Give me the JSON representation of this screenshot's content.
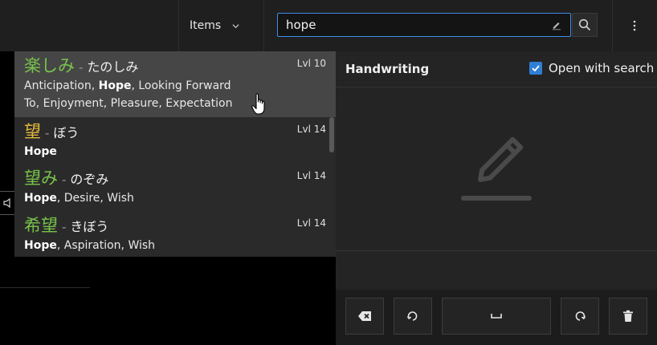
{
  "toolbar": {
    "items_label": "Items",
    "search_value": "hope"
  },
  "results": [
    {
      "word": "楽しみ",
      "reading": "たのしみ",
      "level": "Lvl 10",
      "word_color": "green",
      "meanings_line1": [
        {
          "text": "Anticipation",
          "bold": false
        },
        {
          "text": ", ",
          "bold": false
        },
        {
          "text": "Hope",
          "bold": true
        },
        {
          "text": ", Looking Forward",
          "bold": false
        }
      ],
      "meanings_line2": "To, Enjoyment, Pleasure, Expectation",
      "active": true
    },
    {
      "word": "望",
      "reading": "ぼう",
      "level": "Lvl 14",
      "word_color": "yellow",
      "meanings_line1": [
        {
          "text": "Hope",
          "bold": true
        }
      ],
      "meanings_line2": "",
      "active": false
    },
    {
      "word": "望み",
      "reading": "のぞみ",
      "level": "Lvl 14",
      "word_color": "green",
      "meanings_line1": [
        {
          "text": "Hope",
          "bold": true
        },
        {
          "text": ", Desire, Wish",
          "bold": false
        }
      ],
      "meanings_line2": "",
      "active": false
    },
    {
      "word": "希望",
      "reading": "きぼう",
      "level": "Lvl 14",
      "word_color": "green",
      "meanings_line1": [
        {
          "text": "Hope",
          "bold": true
        },
        {
          "text": ", Aspiration, Wish",
          "bold": false
        }
      ],
      "meanings_line2": "",
      "active": false
    }
  ],
  "handwriting": {
    "title": "Handwriting",
    "open_with_search_label": "Open with search",
    "open_with_search_checked": true
  },
  "colors": {
    "accent": "#3d8ee6",
    "green_word": "#77c44a",
    "yellow_word": "#e5b83e",
    "checkbox": "#2f7fd6"
  },
  "icons": {
    "items_dropdown": "chevron-down-icon",
    "search_field_edit": "pencil-icon",
    "search_button": "search-icon",
    "menu": "more-vertical-icon",
    "canvas_hint": "pencil-icon",
    "backspace": "backspace-icon",
    "undo": "undo-icon",
    "space": "space-icon",
    "redo": "redo-icon",
    "clear": "trash-icon"
  }
}
